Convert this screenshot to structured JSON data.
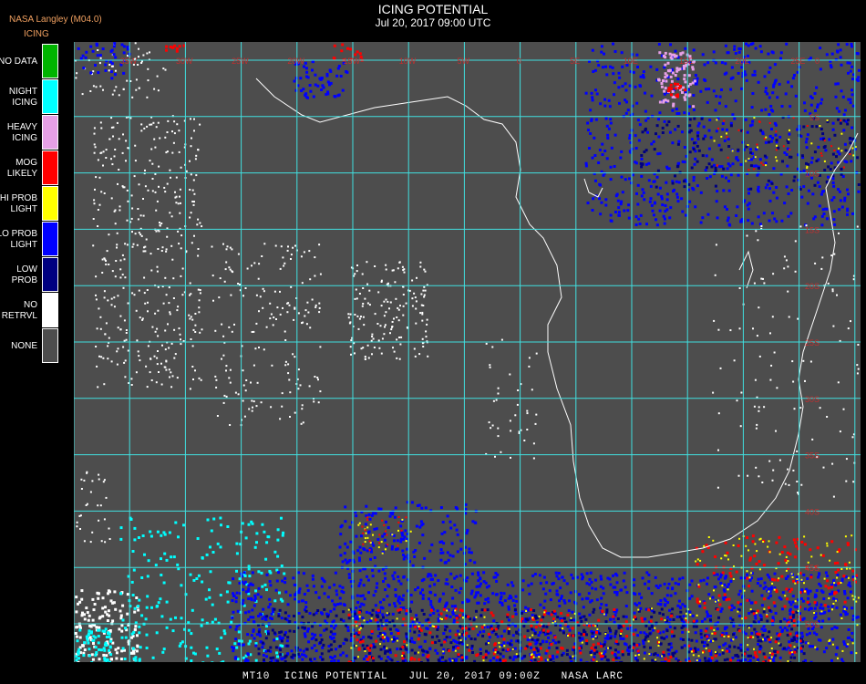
{
  "header": {
    "credit": "NASA Langley (M04.0)",
    "product_label": "ICING",
    "title": "ICING POTENTIAL",
    "subtitle": "Jul 20, 2017 09:00 UTC"
  },
  "legend": [
    {
      "label": "NO DATA",
      "color": "#00b400"
    },
    {
      "label": "NIGHT\nICING",
      "color": "#00ffff"
    },
    {
      "label": "HEAVY\nICING",
      "color": "#e6a0e6"
    },
    {
      "label": "MOG\nLIKELY",
      "color": "#ff0000"
    },
    {
      "label": "HI PROB\nLIGHT",
      "color": "#ffff00"
    },
    {
      "label": "LO PROB\nLIGHT",
      "color": "#0000ff"
    },
    {
      "label": "LOW\nPROB",
      "color": "#000080"
    },
    {
      "label": "NO\nRETRVL",
      "color": "#ffffff"
    },
    {
      "label": "NONE",
      "color": "#4d4d4d"
    }
  ],
  "map": {
    "background_color": "#4d4d4d",
    "grid_color": "#40e0e0",
    "coast_color": "#ffffff",
    "grid_label_color": "#c03030",
    "lon_labels": [
      "40W",
      "35W",
      "30W",
      "25W",
      "20W",
      "15W",
      "10W",
      "5W",
      "0",
      "5E",
      "10E",
      "15E",
      "20E",
      "25E",
      "30E",
      "35E",
      "40E"
    ],
    "lat_labels": [
      "0",
      "5S",
      "10S",
      "15S",
      "20S",
      "25S",
      "30S",
      "35S",
      "40S",
      "45S",
      "50S"
    ]
  },
  "footer": "MT10  ICING POTENTIAL   JUL 20, 2017 09:00Z   NASA LARC"
}
